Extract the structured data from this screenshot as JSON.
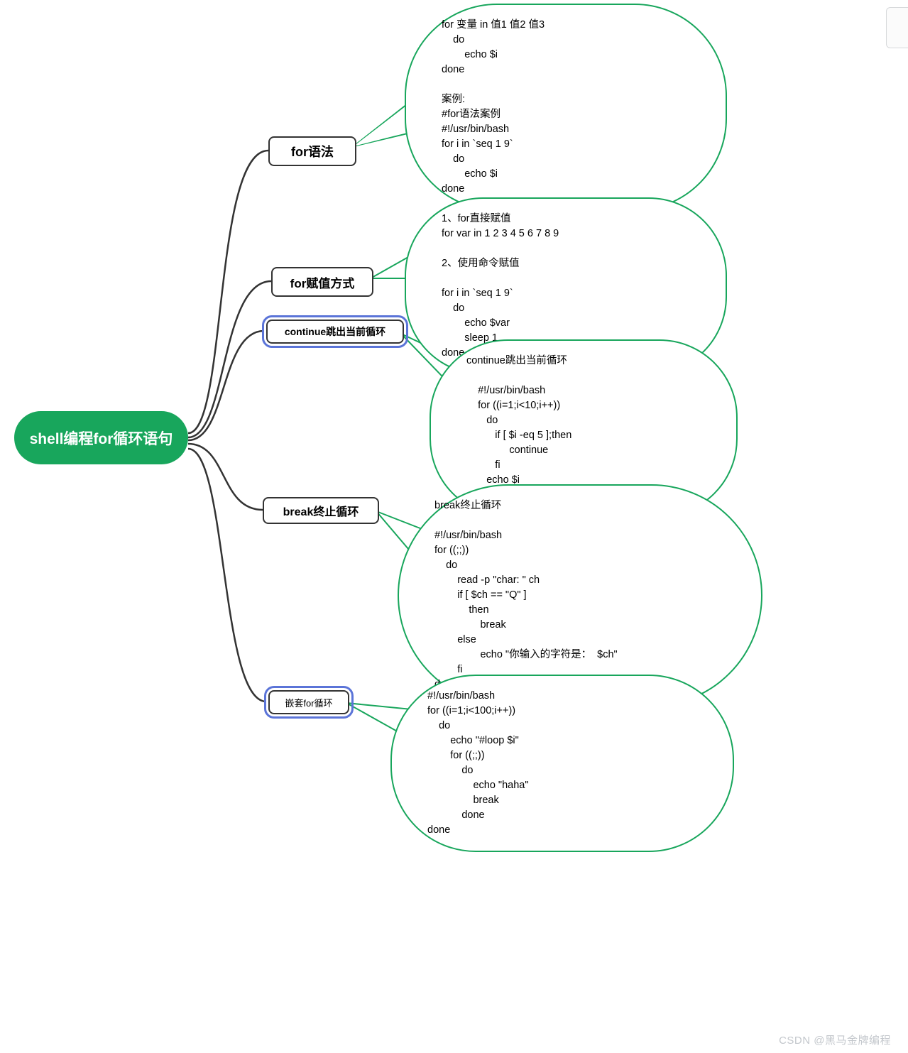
{
  "root": "shell编程for循环语句",
  "nodes": {
    "n1": "for语法",
    "n2": "for赋值方式",
    "n3": "continue跳出当前循环",
    "n4": "break终止循环",
    "n5": "嵌套for循环"
  },
  "bubbles": {
    "b1": "for 变量 in 值1 值2 值3\n    do\n        echo $i\ndone\n\n案例:\n#for语法案例\n#!/usr/bin/bash\nfor i in `seq 1 9`\n    do\n        echo $i\ndone",
    "b2": "1、for直接赋值\nfor var in 1 2 3 4 5 6 7 8 9\n\n2、使用命令赋值\n\nfor i in `seq 1 9`\n    do\n        echo $var\n        sleep 1\ndone",
    "b3": "continue跳出当前循环\n\n    #!/usr/bin/bash\n    for ((i=1;i<10;i++))\n       do\n          if [ $i -eq 5 ];then\n               continue\n          fi\n       echo $i\n    done",
    "b4": "break终止循环\n\n#!/usr/bin/bash\nfor ((;;))\n    do\n        read -p \"char: \" ch\n        if [ $ch == \"Q\" ]\n            then\n                break\n        else\n                echo \"你输入的字符是：  $ch\"\n        fi\ndone",
    "b5": "#!/usr/bin/bash\nfor ((i=1;i<100;i++))\n    do\n        echo \"#loop $i\"\n        for ((;;))\n            do\n                echo \"haha\"\n                break\n            done\ndone"
  },
  "watermark": "CSDN @黑马金牌编程"
}
